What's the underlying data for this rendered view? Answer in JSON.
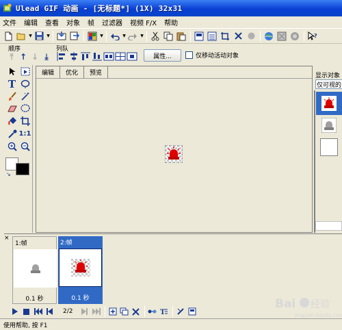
{
  "window": {
    "title": "Ulead GIF 动画 - [无标题*] (1X) 32x31"
  },
  "menu": [
    "文件",
    "编辑",
    "查看",
    "对象",
    "帧",
    "过滤器",
    "视频 F/X",
    "帮助"
  ],
  "toolbar": {
    "icons": [
      "new-file-icon",
      "open-folder-icon",
      "save-disk-icon",
      "import-icon",
      "export-icon",
      "color-picker-icon",
      "undo-icon",
      "redo-icon",
      "cut-icon",
      "copy-icon",
      "paste-icon",
      "layer-icon",
      "align-icon",
      "crop-icon",
      "delete-icon",
      "globe-icon",
      "preview-icon",
      "optimize-icon",
      "whatis-help-icon"
    ]
  },
  "groups": {
    "order_label": "顺序",
    "queue_label": "列队"
  },
  "properties_button": "属性...",
  "move_active_only": {
    "label": "仅移动活动对象",
    "checked": false
  },
  "canvas": {
    "tabs": [
      "编辑",
      "优化",
      "预览"
    ],
    "active_tab": "编辑"
  },
  "object_panel": {
    "title": "显示对象",
    "filter_value": "仅可视的",
    "items": [
      "object-red-beacon",
      "object-gray-beacon",
      "object-blank"
    ]
  },
  "frames": [
    {
      "label": "1:帧",
      "delay": "0.1 秒",
      "selected": false
    },
    {
      "label": "2:帧",
      "delay": "0.1 秒",
      "selected": true
    }
  ],
  "playback": {
    "counter": "2/2"
  },
  "status": {
    "text": "使用帮助, 按 F1"
  },
  "watermark": {
    "text": "Bai 经验",
    "sub": "jingyan.baidu.com"
  },
  "colors": {
    "title_blue": "#0a3fd4",
    "selection_blue": "#316ac5",
    "beacon_red": "#e00000",
    "face": "#ece9d8"
  }
}
